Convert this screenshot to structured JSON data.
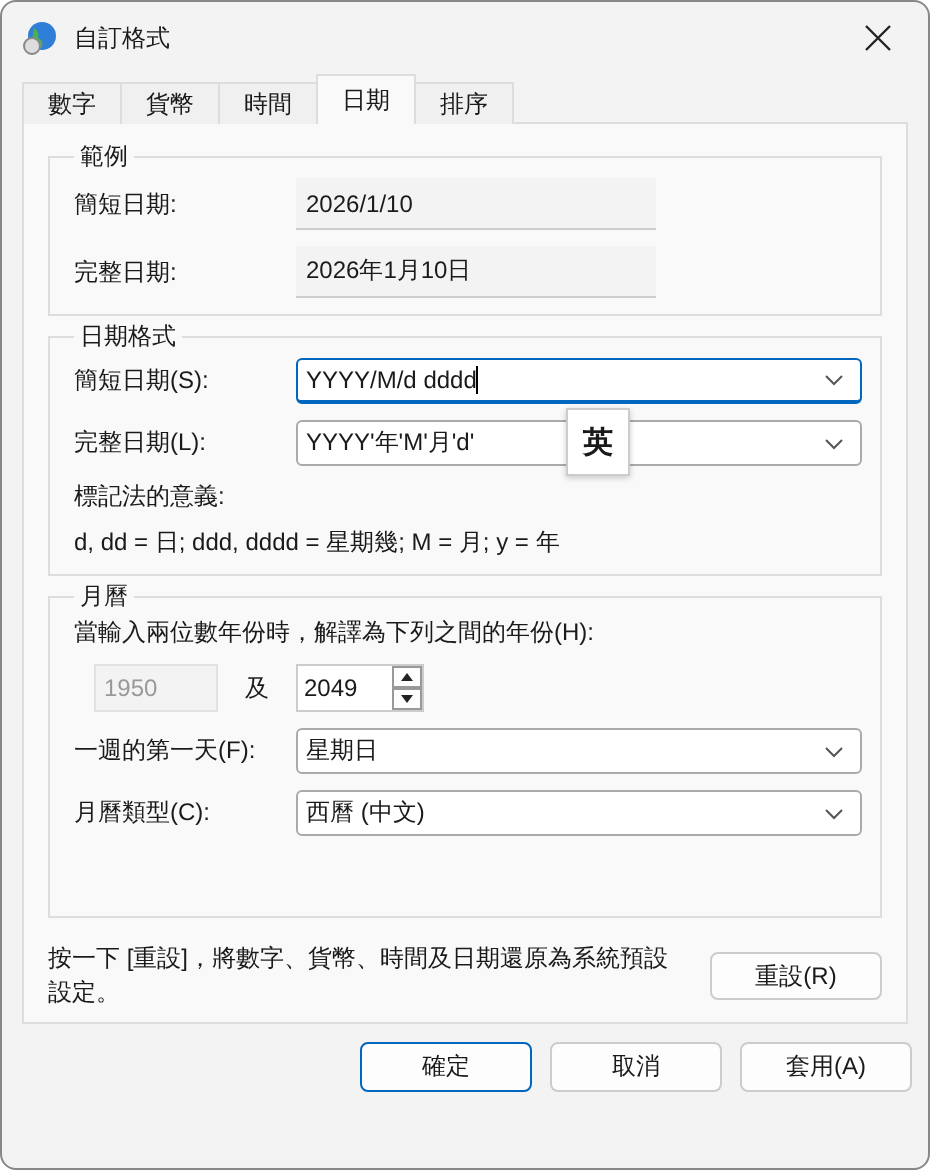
{
  "window": {
    "title": "自訂格式"
  },
  "tabs": [
    {
      "label": "數字",
      "selected": false
    },
    {
      "label": "貨幣",
      "selected": false
    },
    {
      "label": "時間",
      "selected": false
    },
    {
      "label": "日期",
      "selected": true
    },
    {
      "label": "排序",
      "selected": false
    }
  ],
  "example": {
    "title": "範例",
    "rows": [
      {
        "label": "簡短日期:",
        "value": "2026/1/10"
      },
      {
        "label": "完整日期:",
        "value": "2026年1月10日"
      }
    ]
  },
  "date_format": {
    "title": "日期格式",
    "rows": [
      {
        "label": "簡短日期(S):",
        "value": "YYYY/M/d dddd",
        "focused": true
      },
      {
        "label": "完整日期(L):",
        "value": "YYYY'年'M'月'd'",
        "focused": false
      }
    ],
    "ime_indicator": "英",
    "notation_title": "標記法的意義:",
    "notation": "d, dd = 日;  ddd, dddd = 星期幾;  M = 月;  y = 年"
  },
  "calendar": {
    "title": "月曆",
    "two_digit_label": "當輸入兩位數年份時，解譯為下列之間的年份(H):",
    "year_from": {
      "value": "1950",
      "disabled": true
    },
    "and": "及",
    "year_to": "2049",
    "rows": [
      {
        "label": "一週的第一天(F):",
        "value": "星期日"
      },
      {
        "label": "月曆類型(C):",
        "value": "西曆 (中文)"
      }
    ]
  },
  "reset_note": "按一下 [重設]，將數字、貨幣、時間及日期還原為系統預設設定。",
  "reset_button": "重設(R)",
  "buttons": [
    {
      "label": "確定",
      "default": true
    },
    {
      "label": "取消",
      "default": false
    },
    {
      "label": "套用(A)",
      "default": false
    }
  ]
}
